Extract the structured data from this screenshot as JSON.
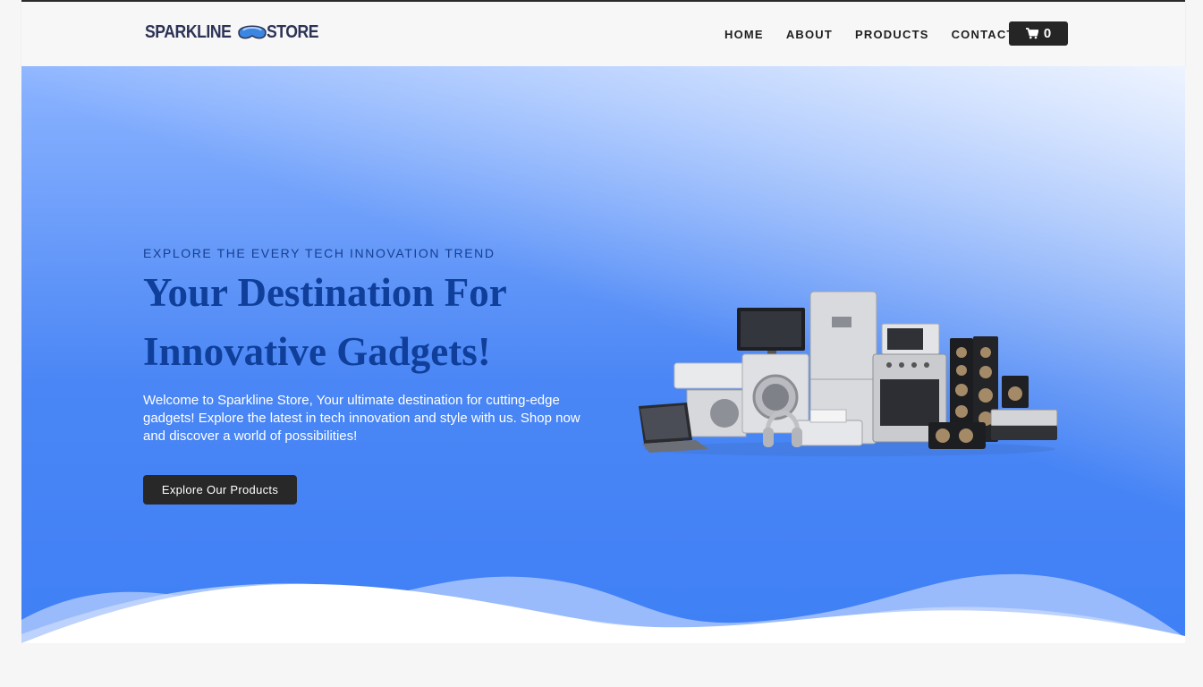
{
  "brand": {
    "name_part1": "SPARKLINE",
    "name_part2": "STORE",
    "logo_icon": "ski-goggles-icon"
  },
  "nav": {
    "items": [
      {
        "label": "HOME"
      },
      {
        "label": "ABOUT"
      },
      {
        "label": "PRODUCTS"
      },
      {
        "label": "CONTACT"
      }
    ],
    "cart_icon": "cart-icon",
    "cart_count": "0"
  },
  "hero": {
    "kicker": "EXPLORE THE EVERY TECH INNOVATION TREND",
    "headline_line1": "Your Destination For",
    "headline_line2": "Innovative Gadgets!",
    "description": "Welcome to Sparkline Store, Your ultimate destination for cutting-edge gadgets! Explore the latest in tech innovation and style with us. Shop now and discover a world of possibilities!",
    "cta_label": "Explore Our Products",
    "image_alt": "home appliances and electronics group"
  },
  "colors": {
    "hero_blue": "#4a86f5",
    "headline": "#0f3f9a",
    "dark_button": "#282828",
    "logo_blue": "#3b86e0"
  }
}
